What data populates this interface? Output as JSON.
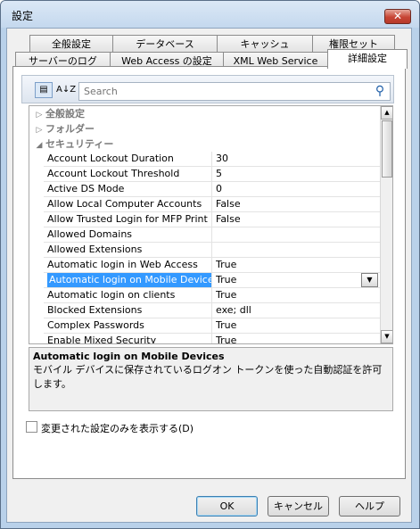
{
  "window": {
    "title": "設定",
    "close_label": "✕"
  },
  "tabs_row1": [
    {
      "label": "全般設定"
    },
    {
      "label": "データベース"
    },
    {
      "label": "キャッシュ"
    },
    {
      "label": "権限セット"
    }
  ],
  "tabs_row2": [
    {
      "label": "サーバーのログ"
    },
    {
      "label": "Web Access の設定"
    },
    {
      "label": "XML Web Service"
    },
    {
      "label": "詳細設定",
      "active": true
    }
  ],
  "toolbar": {
    "categorized_icon": "categorized-icon",
    "sort_icon": "sort-alpha-icon",
    "sort_text": "A↓Z"
  },
  "search": {
    "placeholder": "Search",
    "icon": "search-icon"
  },
  "categories": {
    "general": "全般設定",
    "folders": "フォルダー",
    "security": "セキュリティー"
  },
  "properties": [
    {
      "name": "Account Lockout Duration",
      "value": "30"
    },
    {
      "name": "Account Lockout Threshold",
      "value": "5"
    },
    {
      "name": "Active DS Mode",
      "value": "0"
    },
    {
      "name": "Allow Local Computer Accounts",
      "value": "False"
    },
    {
      "name": "Allow Trusted Login for MFP Print",
      "value": "False"
    },
    {
      "name": "Allowed Domains",
      "value": ""
    },
    {
      "name": "Allowed Extensions",
      "value": ""
    },
    {
      "name": "Automatic login in Web Access",
      "value": "True"
    },
    {
      "name": "Automatic login on Mobile Devices",
      "value": "True",
      "selected": true
    },
    {
      "name": "Automatic login on clients",
      "value": "True"
    },
    {
      "name": "Blocked Extensions",
      "value": "exe; dll"
    },
    {
      "name": "Complex Passwords",
      "value": "True"
    },
    {
      "name": "Enable Mixed Security",
      "value": "True"
    }
  ],
  "help": {
    "title": "Automatic login on Mobile Devices",
    "description": "モバイル デバイスに保存されているログオン トークンを使った自動認証を許可します。"
  },
  "checkbox": {
    "label": "変更された設定のみを表示する(D)",
    "checked": false
  },
  "buttons": {
    "ok": "OK",
    "cancel": "キャンセル",
    "help": "ヘルプ"
  }
}
